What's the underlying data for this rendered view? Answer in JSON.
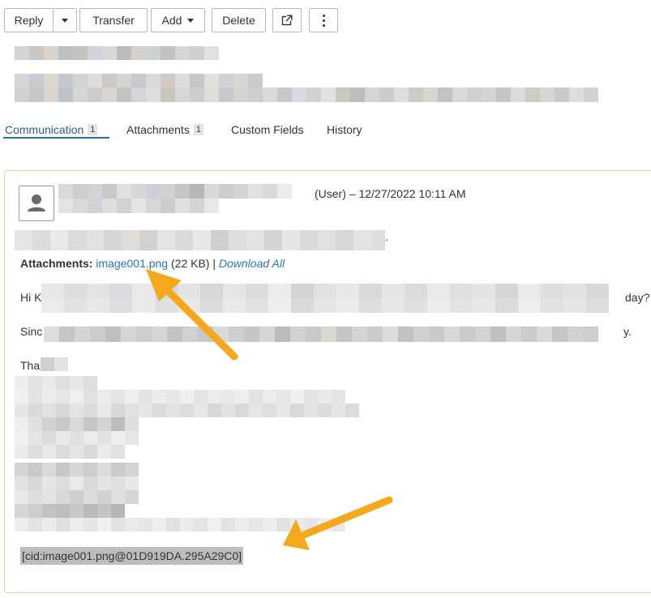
{
  "toolbar": {
    "reply_label": "Reply",
    "transfer_label": "Transfer",
    "add_label": "Add",
    "delete_label": "Delete",
    "icons": [
      "chevron-down-icon",
      "external-link-icon",
      "more-vertical-icon"
    ]
  },
  "tabs": [
    {
      "label": "Communication",
      "count": "1",
      "active": true
    },
    {
      "label": "Attachments",
      "count": "1",
      "active": false
    },
    {
      "label": "Custom Fields",
      "count": "",
      "active": false
    },
    {
      "label": "History",
      "count": "",
      "active": false
    }
  ],
  "message": {
    "sender_meta": "(User) – 12/27/2022 10:11 AM",
    "subject_end": ".",
    "attachments_label": "Attachments:",
    "attachment_name": "image001.png",
    "attachment_size": "(22 KB) |",
    "download_all_label": "Download All",
    "body_fragments": {
      "line1_start": "Hi K",
      "line1_end": "day?",
      "line2_start": "Sinc",
      "line2_end": "y.",
      "line3_start": "Tha"
    },
    "cid_text": "[cid:image001.png@01D919DA.295A29C0]"
  },
  "colors": {
    "accent": "#2e6fa3",
    "link": "#2a78b5",
    "card_border": "#f2c9a0",
    "annotation_arrow": "#f4a81d"
  }
}
